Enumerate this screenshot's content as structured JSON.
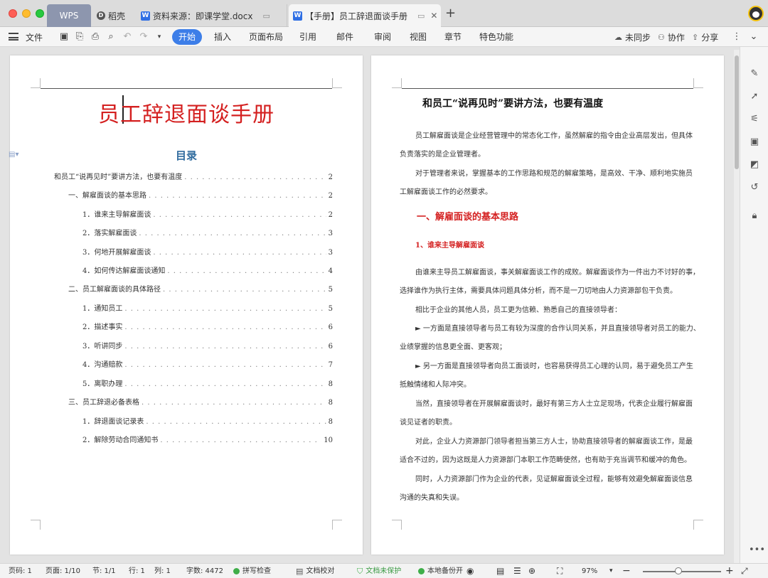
{
  "tabs": {
    "wps": "WPS",
    "daoke": "稻壳",
    "doc1": "资料来源：即课学堂.docx",
    "doc2": "【手册】员工辞退面谈手册",
    "add": "+"
  },
  "toolbar": {
    "file": "文件",
    "menus": [
      "开始",
      "插入",
      "页面布局",
      "引用",
      "邮件",
      "审阅",
      "视图",
      "章节",
      "特色功能"
    ],
    "sync": "未同步",
    "collab": "协作",
    "share": "分享"
  },
  "left_page": {
    "title": "员工辞退面谈手册",
    "toc_heading": "目录",
    "toc": [
      {
        "text": "和员工“说再见时”要讲方法，也要有温度",
        "page": "2",
        "level": 0
      },
      {
        "text": "一、解雇面谈的基本思路",
        "page": "2",
        "level": 1
      },
      {
        "text": "1．谁来主导解雇面谈",
        "page": "2",
        "level": 2
      },
      {
        "text": "2．落实解雇面谈",
        "page": "3",
        "level": 2
      },
      {
        "text": "3．何地开展解雇面谈",
        "page": "3",
        "level": 2
      },
      {
        "text": "4．如何传达解雇面谈通知",
        "page": "4",
        "level": 2
      },
      {
        "text": "二、员工解雇面谈的具体路径",
        "page": "5",
        "level": 1
      },
      {
        "text": "1．通知员工",
        "page": "5",
        "level": 2
      },
      {
        "text": "2．描述事实",
        "page": "6",
        "level": 2
      },
      {
        "text": "3．听讲同步",
        "page": "6",
        "level": 2
      },
      {
        "text": "4．沟通赔款",
        "page": "7",
        "level": 2
      },
      {
        "text": "5．离职办理",
        "page": "8",
        "level": 2
      },
      {
        "text": "三、员工辞退必备表格",
        "page": "8",
        "level": 1
      },
      {
        "text": "1．辞退面谈记录表",
        "page": "8",
        "level": 2
      },
      {
        "text": "2．解除劳动合同通知书",
        "page": "10",
        "level": 2
      }
    ]
  },
  "right_page": {
    "title": "和员工“说再见时”要讲方法，也要有温度",
    "section": "一、解雇面谈的基本思路",
    "subsection": "1、谁来主导解雇面谈",
    "lines_a": [
      "员工解雇面谈是企业经营管理中的常态化工作，虽然解雇的指令由企业高层发出，但具体",
      "负责落实的是企业管理者。",
      "对于管理者来说，掌握基本的工作思路和规范的解雇策略，是高效、干净、顺利地实施员",
      "工解雇面谈工作的必然要求。"
    ],
    "lines_b": [
      "由谁来主导员工解雇面谈，事关解雇面谈工作的成败。解雇面谈作为一件出力不讨好的事，",
      "选择谁作为执行主体，需要具体问题具体分析，而不是一刀切地由人力资源部包干负责。",
      "相比于企业的其他人员，员工更为信赖、熟悉自己的直接领导者：",
      "► 一方面是直接领导者与员工有较为深度的合作认同关系，并且直接领导者对员工的能力、",
      "业绩掌握的信息更全面、更客观；",
      "► 另一方面是直接领导者向员工面谈时，也容易获得员工心理的认同，易于避免员工产生",
      "抵触情绪和人际冲突。",
      "当然，直接领导者在开展解雇面谈时，最好有第三方人士立足现场，代表企业履行解雇面",
      "谈见证者的职责。",
      "对此，企业人力资源部门领导者担当第三方人士，协助直接领导者的解雇面谈工作，是最",
      "适合不过的，因为这既是人力资源部门本职工作范畴使然，也有助于充当调节和缓冲的角色。",
      "同时，人力资源部门作为企业的代表，见证解雇面谈全过程，能够有效避免解雇面谈信息",
      "沟通的失真和失误。"
    ]
  },
  "statusbar": {
    "page_num": "页码: 1",
    "page_of": "页面: 1/10",
    "section": "节: 1/1",
    "row": "行: 1",
    "col": "列: 1",
    "word_count": "字数: 4472",
    "spell": "拼写检查",
    "proof": "文档校对",
    "protect": "文档未保护",
    "backup": "本地备份开",
    "zoom": "97%",
    "zoom_fraction": 0.45
  },
  "colors": {
    "accent": "#3d7ee8",
    "title_red": "#d42020",
    "toc_blue": "#2f6b9e"
  }
}
